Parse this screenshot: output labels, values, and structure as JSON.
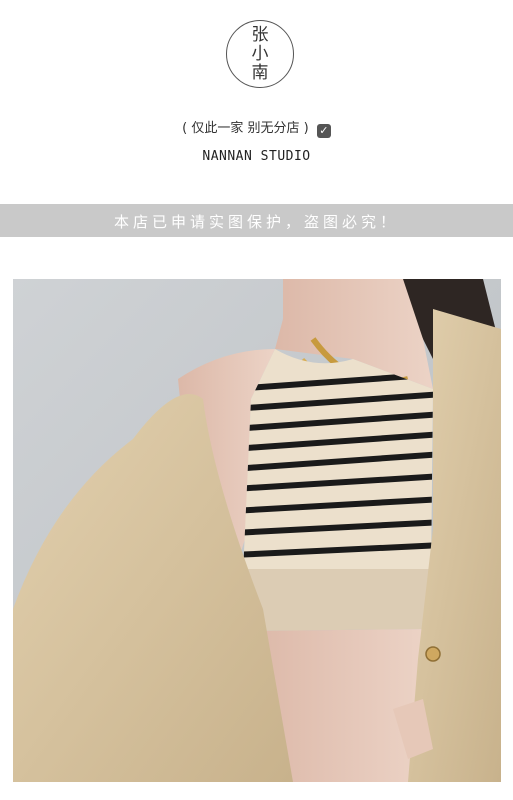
{
  "logo": {
    "line1": "张",
    "line2": "小",
    "line3": "南"
  },
  "notice": {
    "text": "( 仅此一家 别无分店 )",
    "check_icon": "check-square-icon"
  },
  "studio_name": "NANNAN STUDIO",
  "banner": {
    "text": "本店已申请实图保护，盗图必究！"
  },
  "colors": {
    "banner": "#c9c9c9",
    "blazer": "#d8c4a0",
    "stripe": "#1a1a1a"
  }
}
